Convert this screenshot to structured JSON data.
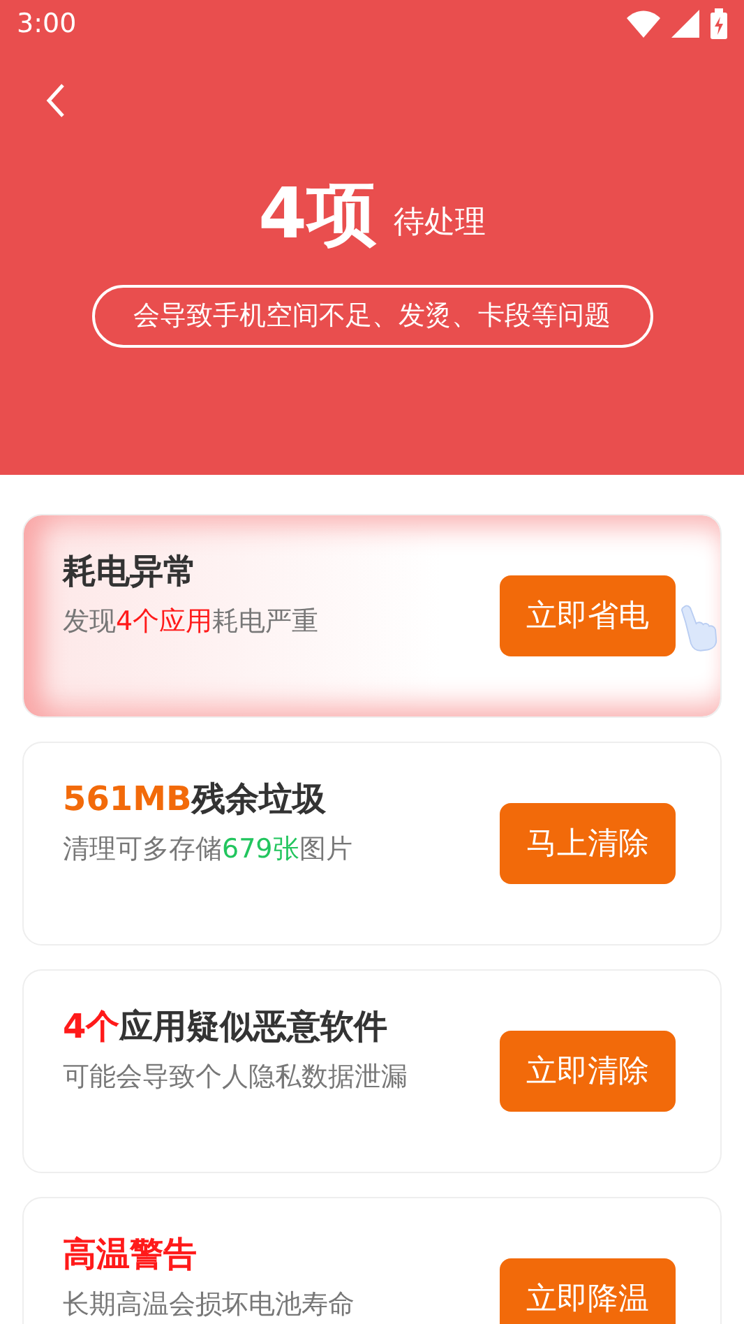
{
  "status_bar": {
    "time": "3:00"
  },
  "header": {
    "count": "4项",
    "count_label": "待处理",
    "notice": "会导致手机空间不足、发烫、卡段等问题"
  },
  "cards": [
    {
      "highlighted": true,
      "title": [
        {
          "text": "耗电异常",
          "color": "#333333"
        }
      ],
      "subtitle": [
        {
          "text": "发现",
          "color": "#777777"
        },
        {
          "text": "4个应用",
          "color": "#ff1a1a"
        },
        {
          "text": "耗电严重",
          "color": "#777777"
        }
      ],
      "button": "立即省电",
      "pointer": true
    },
    {
      "highlighted": false,
      "title": [
        {
          "text": "561MB",
          "color": "#f26a0a"
        },
        {
          "text": "残余垃圾",
          "color": "#333333"
        }
      ],
      "subtitle": [
        {
          "text": "清理可多存储",
          "color": "#777777"
        },
        {
          "text": "679张",
          "color": "#22c55e"
        },
        {
          "text": "图片",
          "color": "#777777"
        }
      ],
      "button": "马上清除",
      "pointer": false
    },
    {
      "highlighted": false,
      "title": [
        {
          "text": "4个",
          "color": "#ff1a1a"
        },
        {
          "text": "应用疑似恶意软件",
          "color": "#333333"
        }
      ],
      "subtitle": [
        {
          "text": "可能会导致个人隐私数据泄漏",
          "color": "#777777"
        }
      ],
      "button": "立即清除",
      "pointer": false
    },
    {
      "highlighted": false,
      "title": [
        {
          "text": "高温警告",
          "color": "#ff1a1a"
        }
      ],
      "subtitle": [
        {
          "text": "长期高温会损坏电池寿命",
          "color": "#777777"
        }
      ],
      "button": "立即降温",
      "pointer": false
    }
  ]
}
